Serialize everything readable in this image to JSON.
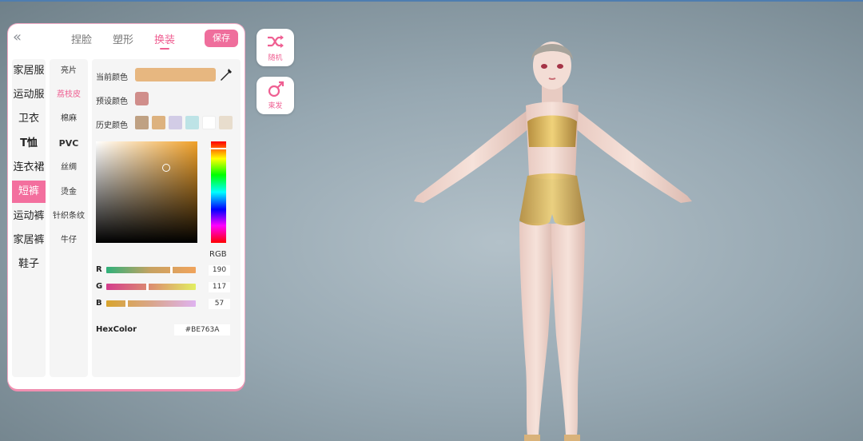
{
  "tabs": [
    {
      "label": "捏脸"
    },
    {
      "label": "塑形"
    },
    {
      "label": "换装"
    }
  ],
  "save_label": "保存",
  "categories": [
    {
      "label": "家居服"
    },
    {
      "label": "运动服"
    },
    {
      "label": "卫衣"
    },
    {
      "label": "T恤"
    },
    {
      "label": "连衣裙"
    },
    {
      "label": "短裤"
    },
    {
      "label": "运动裤"
    },
    {
      "label": "家居裤"
    },
    {
      "label": "鞋子"
    }
  ],
  "selected_category": "短裤",
  "materials": [
    {
      "label": "亮片"
    },
    {
      "label": "荔枝皮"
    },
    {
      "label": "棉麻"
    },
    {
      "label": "PVC"
    },
    {
      "label": "丝绸"
    },
    {
      "label": "烫金"
    },
    {
      "label": "针织条纹"
    },
    {
      "label": "牛仔"
    }
  ],
  "selected_material": "荔枝皮",
  "color_panel": {
    "current_label": "当前颜色",
    "current_color": "#E7B780",
    "preset_label": "预设颜色",
    "preset_color": "#D08E8B",
    "history_label": "历史颜色",
    "history_colors": [
      "#BFA183",
      "#DDB27F",
      "#D2CCE6",
      "#BDE3E6",
      "#FFFFFF",
      "#E8DDCD"
    ],
    "mode_label": "RGB",
    "r_label": "R",
    "r_value": "190",
    "g_label": "G",
    "g_value": "117",
    "b_label": "B",
    "b_value": "57",
    "hex_label": "HexColor",
    "hex_value": "#BE763A"
  },
  "side_buttons": {
    "random_label": "随机",
    "hair_label": "束发"
  },
  "colors": {
    "accent": "#EF5F92",
    "panel_bg": "#FFFFFF",
    "column_bg": "#F5F5F5"
  }
}
